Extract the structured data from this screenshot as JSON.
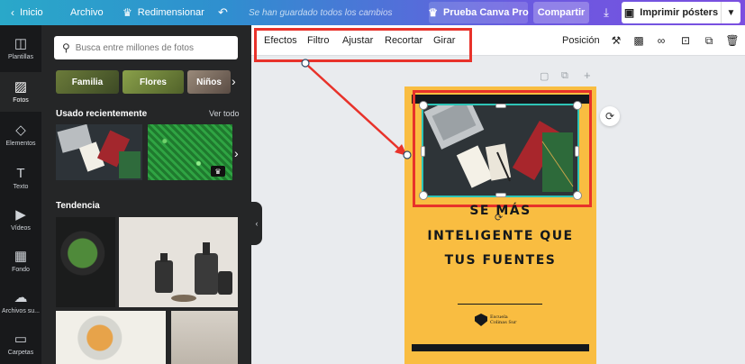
{
  "topbar": {
    "home": "Inicio",
    "file": "Archivo",
    "resize": "Redimensionar",
    "saved_hint": "Se han guardado todos los cambios",
    "trial": "Prueba Canva Pro",
    "share": "Compartir",
    "print": "Imprimir pósters"
  },
  "rail": [
    {
      "label": "Plantillas",
      "icon": "template-icon"
    },
    {
      "label": "Fotos",
      "icon": "photo-icon"
    },
    {
      "label": "Elementos",
      "icon": "elements-icon"
    },
    {
      "label": "Texto",
      "icon": "text-icon"
    },
    {
      "label": "Vídeos",
      "icon": "video-icon"
    },
    {
      "label": "Fondo",
      "icon": "background-icon"
    },
    {
      "label": "Archivos su...",
      "icon": "upload-icon"
    },
    {
      "label": "Carpetas",
      "icon": "folder-icon"
    }
  ],
  "panel": {
    "search_placeholder": "Busca entre millones de fotos",
    "categories": [
      "Familia",
      "Flores",
      "Niños"
    ],
    "recent_title": "Usado recientemente",
    "see_all": "Ver todo",
    "trending_title": "Tendencia"
  },
  "toolbar": {
    "effects": "Efectos",
    "filter": "Filtro",
    "adjust": "Ajustar",
    "crop": "Recortar",
    "flip": "Girar",
    "position": "Posición"
  },
  "poster": {
    "line1": "SE MÁS",
    "line2": "INTELIGENTE QUE",
    "line3": "TUS FUENTES",
    "logo_line1": "Escuela",
    "logo_line2": "Colinas Sur"
  },
  "colors": {
    "accent_red": "#e8322a",
    "poster_yellow": "#f9bd41",
    "selection_teal": "#2ec4b6",
    "dark_panel": "#252627"
  }
}
